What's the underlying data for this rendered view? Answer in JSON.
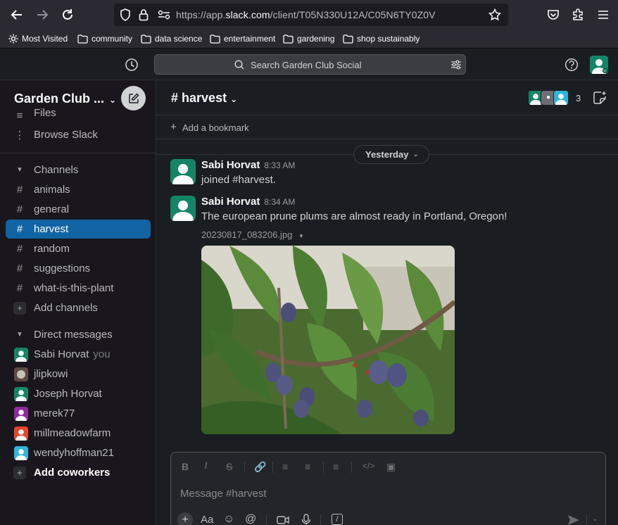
{
  "browser": {
    "url_prefix": "https://app.",
    "url_domain": "slack.com",
    "url_path": "/client/T05N330U12A/C05N6TY0Z0V",
    "bookmarks": [
      "Most Visited",
      "community",
      "data science",
      "entertainment",
      "gardening",
      "shop sustainably"
    ]
  },
  "topbar": {
    "search_placeholder": "Search Garden Club Social"
  },
  "sidebar": {
    "workspace_name": "Garden Club ...",
    "files_label": "Files",
    "browse_label": "Browse Slack",
    "channels_header": "Channels",
    "channels": [
      "animals",
      "general",
      "harvest",
      "random",
      "suggestions",
      "what-is-this-plant"
    ],
    "active_channel": "harvest",
    "add_channels_label": "Add channels",
    "dm_header": "Direct messages",
    "dms": [
      {
        "name": "Sabi Horvat",
        "suffix": "you"
      },
      {
        "name": "jlipkowi",
        "suffix": ""
      },
      {
        "name": "Joseph Horvat",
        "suffix": ""
      },
      {
        "name": "merek77",
        "suffix": ""
      },
      {
        "name": "millmeadowfarm",
        "suffix": ""
      },
      {
        "name": "wendyhoffman21",
        "suffix": ""
      }
    ],
    "add_coworkers_label": "Add coworkers"
  },
  "channel": {
    "title": "harvest",
    "member_count": "3",
    "add_bookmark_label": "Add a bookmark",
    "date_divider": "Yesterday"
  },
  "messages": [
    {
      "author": "Sabi Horvat",
      "time": "8:33 AM",
      "text": "joined #harvest."
    },
    {
      "author": "Sabi Horvat",
      "time": "8:34 AM",
      "text": "The european prune plums are almost ready in Portland, Oregon!",
      "file": "20230817_083206.jpg"
    }
  ],
  "composer": {
    "placeholder": "Message #harvest"
  },
  "colors": {
    "active_channel_bg": "#1164a3",
    "avatar_green": "#148567",
    "presence_green": "#2bac76"
  }
}
